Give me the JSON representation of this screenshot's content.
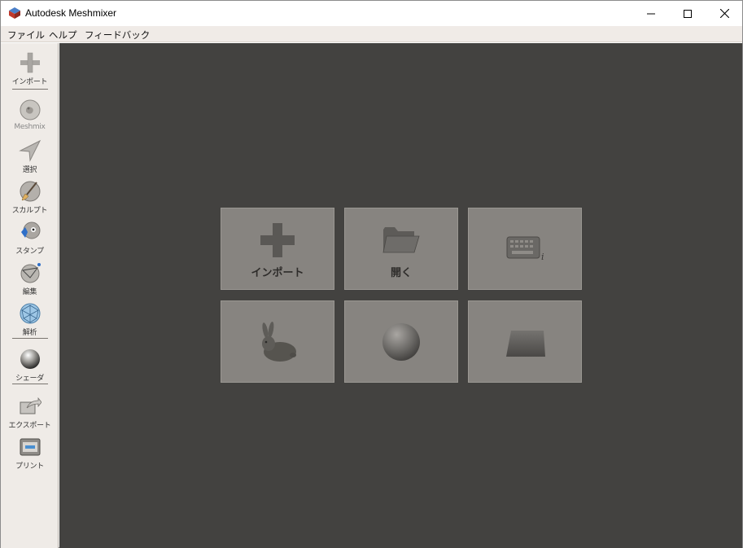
{
  "window": {
    "title": "Autodesk Meshmixer",
    "minimize_icon": "minimize-icon",
    "maximize_icon": "maximize-icon",
    "close_icon": "close-icon"
  },
  "menu": {
    "items": [
      "ファイル",
      "ヘルプ",
      "フィードバック"
    ]
  },
  "toolbar": {
    "tools": [
      {
        "label": "インポート",
        "icon": "plus-icon"
      },
      {
        "label": "Meshmix",
        "icon": "meshmix-icon"
      },
      {
        "label": "選択",
        "icon": "select-arrow-icon"
      },
      {
        "label": "スカルプト",
        "icon": "sculpt-brush-icon"
      },
      {
        "label": "スタンプ",
        "icon": "stamp-icon"
      },
      {
        "label": "編集",
        "icon": "edit-icon"
      },
      {
        "label": "解析",
        "icon": "analysis-icon"
      },
      {
        "label": "シェーダ",
        "icon": "shader-icon"
      },
      {
        "label": "エクスポート",
        "icon": "export-icon"
      },
      {
        "label": "プリント",
        "icon": "print-icon"
      }
    ]
  },
  "start_tiles": [
    {
      "label": "インポート",
      "icon": "import-plus-icon"
    },
    {
      "label": "開く",
      "icon": "open-folder-icon"
    },
    {
      "label": "",
      "icon": "keyboard-shortcuts-icon"
    },
    {
      "label": "",
      "icon": "bunny-icon"
    },
    {
      "label": "",
      "icon": "sphere-icon"
    },
    {
      "label": "",
      "icon": "plane-icon"
    }
  ],
  "colors": {
    "canvas": "#434240",
    "tile": "#878480",
    "toolbar": "#efebe7"
  }
}
